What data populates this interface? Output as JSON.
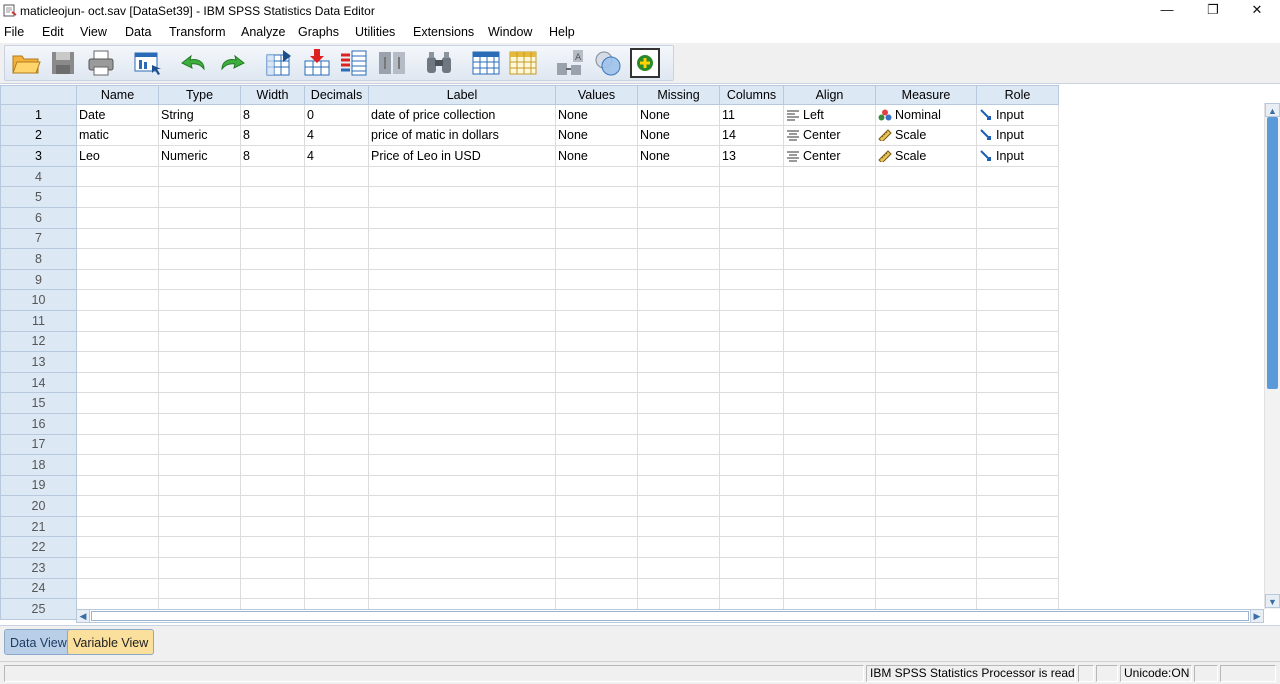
{
  "window": {
    "title": "maticleojun- oct.sav [DataSet39] - IBM SPSS Statistics Data Editor",
    "minimize_glyph": "—",
    "restore_glyph": "❐",
    "close_glyph": "✕"
  },
  "menu": [
    "File",
    "Edit",
    "View",
    "Data",
    "Transform",
    "Analyze",
    "Graphs",
    "Utilities",
    "Extensions",
    "Window",
    "Help"
  ],
  "toolbar": {
    "icons": [
      "open-folder-icon",
      "save-icon",
      "print-icon",
      "recall-dialog-icon",
      "undo-icon",
      "redo-icon",
      "goto-case-icon",
      "goto-variable-icon",
      "variables-icon",
      "split-file-icon",
      "find-icon",
      "insert-cases-icon",
      "insert-variable-icon",
      "select-cases-icon",
      "value-labels-icon",
      "use-variable-sets-icon",
      "spelling-icon"
    ]
  },
  "grid": {
    "columns": [
      "Name",
      "Type",
      "Width",
      "Decimals",
      "Label",
      "Values",
      "Missing",
      "Columns",
      "Align",
      "Measure",
      "Role"
    ],
    "rows": [
      {
        "num": "1",
        "name": "Date",
        "type": "String",
        "width": "8",
        "decimals": "0",
        "label": "date of price collection",
        "values": "None",
        "missing": "None",
        "columns": "11",
        "align": "Left",
        "measure": "Nominal",
        "role": "Input"
      },
      {
        "num": "2",
        "name": "matic",
        "type": "Numeric",
        "width": "8",
        "decimals": "4",
        "label": "price of matic in dollars",
        "values": "None",
        "missing": "None",
        "columns": "14",
        "align": "Center",
        "measure": "Scale",
        "role": "Input"
      },
      {
        "num": "3",
        "name": "Leo",
        "type": "Numeric",
        "width": "8",
        "decimals": "4",
        "label": "Price of Leo in USD",
        "values": "None",
        "missing": "None",
        "columns": "13",
        "align": "Center",
        "measure": "Scale",
        "role": "Input"
      }
    ],
    "empty_row_numbers": [
      "4",
      "5",
      "6",
      "7",
      "8",
      "9",
      "10",
      "11",
      "12",
      "13",
      "14",
      "15",
      "16",
      "17",
      "18",
      "19",
      "20",
      "21",
      "22",
      "23",
      "24",
      "25"
    ],
    "accent_color": "#dde8f5"
  },
  "tabs": {
    "data_view": "Data View",
    "variable_view": "Variable View",
    "active": "Variable View",
    "active_color": "#fbdf9c"
  },
  "status": {
    "processor": "IBM SPSS Statistics Processor is ready",
    "unicode": "Unicode:ON"
  }
}
